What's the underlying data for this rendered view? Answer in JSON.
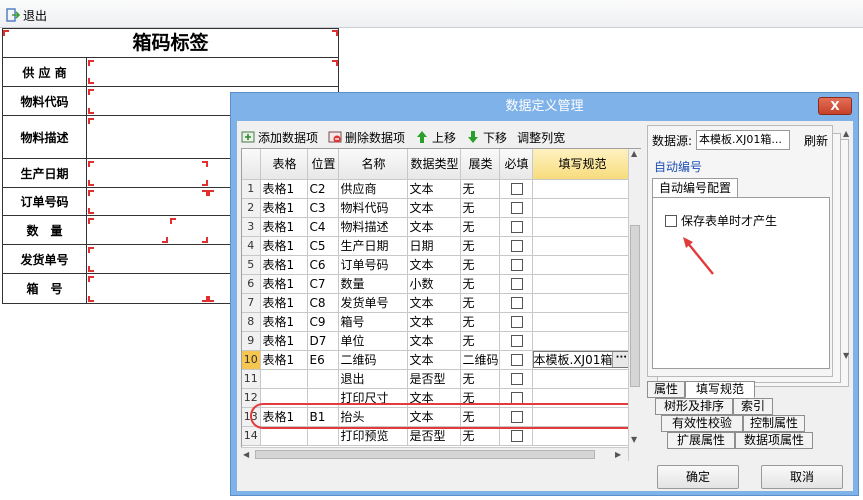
{
  "toolbar": {
    "exit_label": "退出"
  },
  "sheet": {
    "title": "箱码标签",
    "labels": [
      "供 应 商",
      "物料代码",
      "物料描述",
      "生产日期",
      "订单号码",
      "数　量",
      "发货单号",
      "箱　号"
    ]
  },
  "dialog": {
    "title": "数据定义管理",
    "close_label": "X",
    "tools": {
      "add": "添加数据项",
      "delete": "删除数据项",
      "up": "上移",
      "down": "下移",
      "adjust": "调整列宽"
    },
    "columns": [
      "表格",
      "位置",
      "名称",
      "数据类型",
      "展类",
      "必填",
      "填写规范"
    ],
    "rows": [
      {
        "n": "1",
        "table": "表格1",
        "pos": "C2",
        "name": "供应商",
        "type": "文本",
        "ext": "无",
        "spec": ""
      },
      {
        "n": "2",
        "table": "表格1",
        "pos": "C3",
        "name": "物料代码",
        "type": "文本",
        "ext": "无",
        "spec": ""
      },
      {
        "n": "3",
        "table": "表格1",
        "pos": "C4",
        "name": "物料描述",
        "type": "文本",
        "ext": "无",
        "spec": ""
      },
      {
        "n": "4",
        "table": "表格1",
        "pos": "C5",
        "name": "生产日期",
        "type": "日期",
        "ext": "无",
        "spec": ""
      },
      {
        "n": "5",
        "table": "表格1",
        "pos": "C6",
        "name": "订单号码",
        "type": "文本",
        "ext": "无",
        "spec": ""
      },
      {
        "n": "6",
        "table": "表格1",
        "pos": "C7",
        "name": "数量",
        "type": "小数",
        "ext": "无",
        "spec": ""
      },
      {
        "n": "7",
        "table": "表格1",
        "pos": "C8",
        "name": "发货单号",
        "type": "文本",
        "ext": "无",
        "spec": ""
      },
      {
        "n": "8",
        "table": "表格1",
        "pos": "C9",
        "name": "箱号",
        "type": "文本",
        "ext": "无",
        "spec": ""
      },
      {
        "n": "9",
        "table": "表格1",
        "pos": "D7",
        "name": "单位",
        "type": "文本",
        "ext": "无",
        "spec": ""
      },
      {
        "n": "10",
        "table": "表格1",
        "pos": "E6",
        "name": "二维码",
        "type": "文本",
        "ext": "二维码",
        "spec": "本模板.XJ01箱"
      },
      {
        "n": "11",
        "table": "",
        "pos": "",
        "name": "退出",
        "type": "是否型",
        "ext": "无",
        "spec": ""
      },
      {
        "n": "12",
        "table": "",
        "pos": "",
        "name": "打印尺寸",
        "type": "文本",
        "ext": "无",
        "spec": ""
      },
      {
        "n": "13",
        "table": "表格1",
        "pos": "B1",
        "name": "抬头",
        "type": "文本",
        "ext": "无",
        "spec": ""
      },
      {
        "n": "14",
        "table": "",
        "pos": "",
        "name": "打印预览",
        "type": "是否型",
        "ext": "无",
        "spec": ""
      }
    ],
    "right": {
      "datasource_label": "数据源:",
      "datasource_value": "本模板.XJ01箱...",
      "refresh": "刷新",
      "section": "自动编号",
      "subtab": "自动编号配置",
      "checkbox_label": "保存表单时才产生",
      "tabs_row1": [
        "属性",
        "填写规范"
      ],
      "tabs_row2": [
        "树形及排序",
        "索引"
      ],
      "tabs_row3": [
        "有效性校验",
        "控制属性"
      ],
      "tabs_row4": [
        "扩展属性",
        "数据项属性"
      ]
    },
    "ok": "确定",
    "cancel": "取消"
  },
  "colors": {
    "accent_red": "#e23b3b",
    "title_blue": "#7fb2e8",
    "selected_row_marker": "#f6c651"
  }
}
